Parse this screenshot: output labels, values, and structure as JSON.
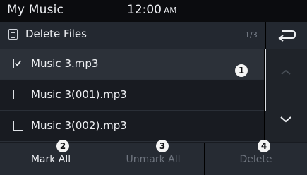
{
  "status_bar": {
    "title": "My Music",
    "time": "12:00",
    "ampm": "AM"
  },
  "header": {
    "icon": "list-icon",
    "title": "Delete Files",
    "page": "1/3",
    "back_icon": "back-arrow-icon"
  },
  "files": [
    {
      "name": "Music 3.mp3",
      "checked": true
    },
    {
      "name": "Music 3(001).mp3",
      "checked": false
    },
    {
      "name": "Music 3(002).mp3",
      "checked": false
    }
  ],
  "scroll": {
    "up_icon": "chevron-up-icon",
    "down_icon": "chevron-down-icon"
  },
  "callouts": [
    "1",
    "2",
    "3",
    "4"
  ],
  "buttons": {
    "mark_all": "Mark All",
    "unmark_all": "Unmark All",
    "delete": "Delete"
  }
}
